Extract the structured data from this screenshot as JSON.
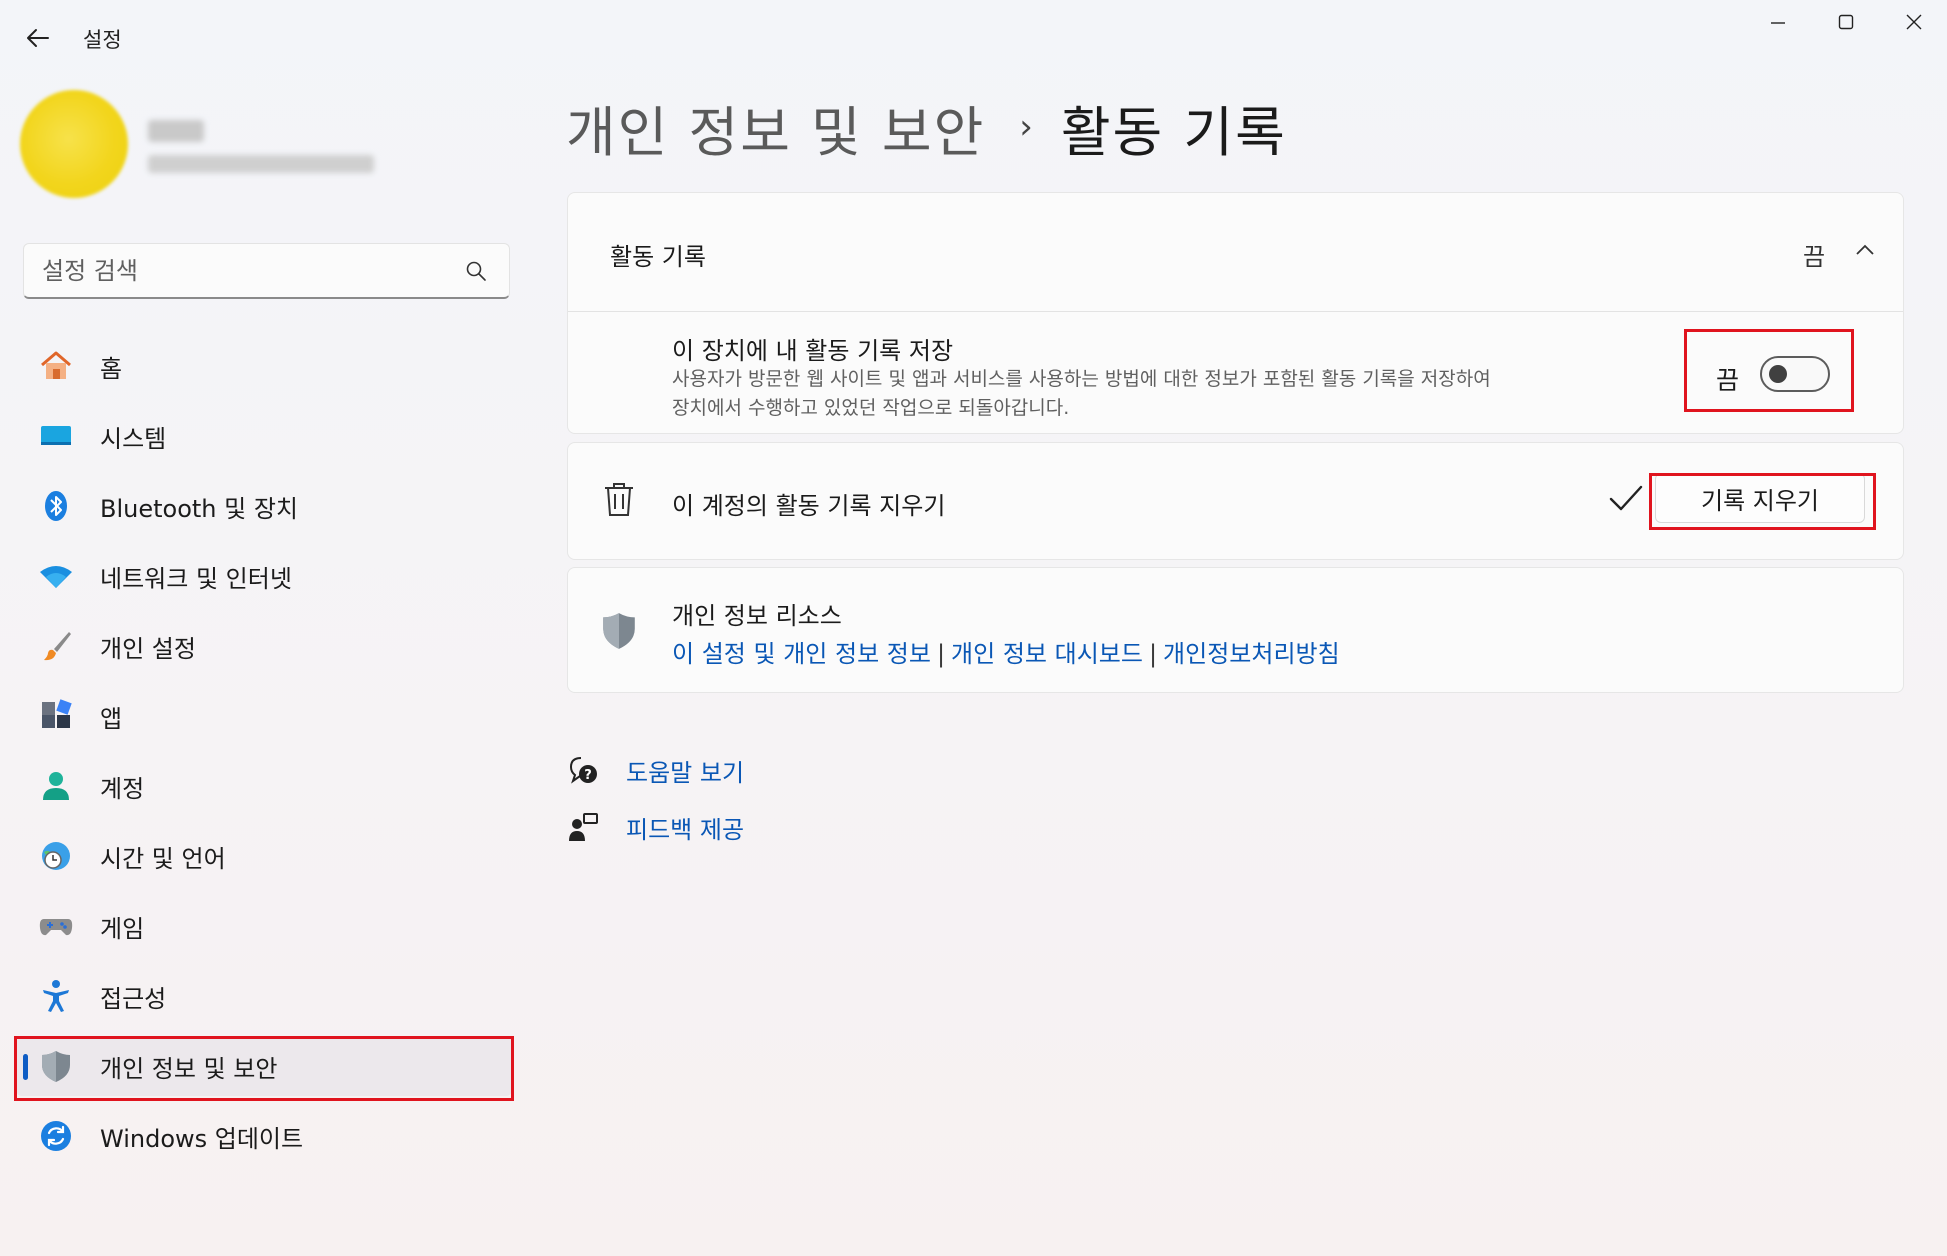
{
  "window": {
    "app_title": "설정"
  },
  "search": {
    "placeholder": "설정 검색"
  },
  "sidebar": {
    "items": [
      {
        "label": "홈",
        "icon": "home-icon"
      },
      {
        "label": "시스템",
        "icon": "system-icon"
      },
      {
        "label": "Bluetooth 및 장치",
        "icon": "bluetooth-icon"
      },
      {
        "label": "네트워크 및 인터넷",
        "icon": "wifi-icon"
      },
      {
        "label": "개인 설정",
        "icon": "brush-icon"
      },
      {
        "label": "앱",
        "icon": "apps-icon"
      },
      {
        "label": "계정",
        "icon": "account-icon"
      },
      {
        "label": "시간 및 언어",
        "icon": "clock-globe-icon"
      },
      {
        "label": "게임",
        "icon": "gamepad-icon"
      },
      {
        "label": "접근성",
        "icon": "accessibility-icon"
      },
      {
        "label": "개인 정보 및 보안",
        "icon": "shield-icon",
        "selected": true
      },
      {
        "label": "Windows 업데이트",
        "icon": "update-icon"
      }
    ]
  },
  "breadcrumb": {
    "parent": "개인 정보 및 보안",
    "separator": "›",
    "current": "활동 기록"
  },
  "activity_card": {
    "title": "활동 기록",
    "status": "끔",
    "setting_title": "이 장치에 내 활동 기록 저장",
    "setting_desc_line1": "사용자가 방문한 웹 사이트 및 앱과 서비스를 사용하는 방법에 대한 정보가 포함된 활동 기록을 저장하여",
    "setting_desc_line2": "장치에서 수행하고 있었던 작업으로 되돌아갑니다.",
    "toggle_label": "끔",
    "toggle_on": false
  },
  "clear_card": {
    "text": "이 계정의 활동 기록 지우기",
    "button_label": "기록 지우기"
  },
  "resources_card": {
    "title": "개인 정보 리소스",
    "links": [
      "이 설정 및 개인 정보 정보",
      "개인 정보 대시보드",
      "개인정보처리방침"
    ],
    "separator": "|"
  },
  "help": {
    "get_help": "도움말 보기",
    "feedback": "피드백 제공"
  },
  "colors": {
    "accent": "#0e5cc4",
    "link": "#0a57b5",
    "highlight_box": "#e0141e"
  }
}
